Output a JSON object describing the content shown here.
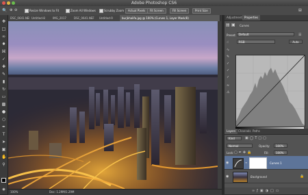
{
  "app": {
    "title": "Adobe Photoshop CS6"
  },
  "options_bar": {
    "resize_windows": "Resize Windows to Fit",
    "zoom_all_windows": "Zoom All Windows",
    "scrubby_zoom": "Scrubby Zoom",
    "actual_pixels": "Actual Pixels",
    "fit_screen": "Fit Screen",
    "fill_screen": "Fill Screen",
    "print_size": "Print Size"
  },
  "document_tabs": [
    {
      "label": "DSC_0641.NEF",
      "active": false
    },
    {
      "label": "Untitled-8",
      "active": false
    },
    {
      "label": "IMG_2017",
      "active": false
    },
    {
      "label": "DSC_0641.NEF",
      "active": false
    },
    {
      "label": "Untitled-9",
      "active": false
    },
    {
      "label": "burjkhalifa.jpg @ 100% (Curves 1, Layer Mask/8)",
      "active": true
    }
  ],
  "status_bar": {
    "zoom": "100%",
    "doc_size": "Doc: 1.29M/1.29M"
  },
  "properties_panel": {
    "tabs": [
      "Adjustments",
      "Properties"
    ],
    "active_tab": "Properties",
    "type_label": "Curves",
    "preset_label": "Preset:",
    "preset_value": "Default",
    "channel_value": "RGB",
    "auto_label": "Auto"
  },
  "layers_panel": {
    "tabs": [
      "Layers",
      "Channels",
      "Paths"
    ],
    "kind_label": "Kind",
    "blend_mode": "Normal",
    "opacity_label": "Opacity:",
    "opacity_value": "100%",
    "lock_label": "Lock:",
    "fill_label": "Fill:",
    "fill_value": "100%",
    "layers": [
      {
        "name": "Curves 1"
      },
      {
        "name": "Background"
      }
    ]
  },
  "colors": {
    "accent_selected": "#5d7499",
    "panel_bg": "#535353"
  }
}
